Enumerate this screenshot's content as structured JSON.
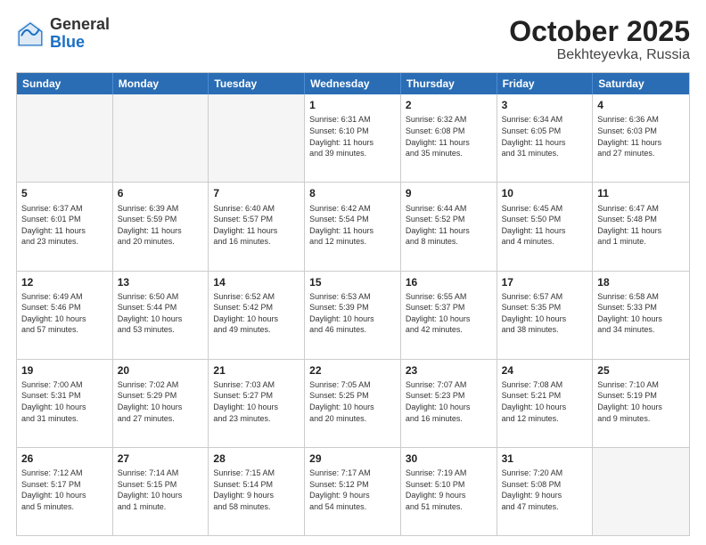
{
  "header": {
    "logo": {
      "general": "General",
      "blue": "Blue"
    },
    "month": "October 2025",
    "location": "Bekhteyevka, Russia"
  },
  "weekdays": [
    "Sunday",
    "Monday",
    "Tuesday",
    "Wednesday",
    "Thursday",
    "Friday",
    "Saturday"
  ],
  "rows": [
    [
      {
        "day": "",
        "info": ""
      },
      {
        "day": "",
        "info": ""
      },
      {
        "day": "",
        "info": ""
      },
      {
        "day": "1",
        "info": "Sunrise: 6:31 AM\nSunset: 6:10 PM\nDaylight: 11 hours\nand 39 minutes."
      },
      {
        "day": "2",
        "info": "Sunrise: 6:32 AM\nSunset: 6:08 PM\nDaylight: 11 hours\nand 35 minutes."
      },
      {
        "day": "3",
        "info": "Sunrise: 6:34 AM\nSunset: 6:05 PM\nDaylight: 11 hours\nand 31 minutes."
      },
      {
        "day": "4",
        "info": "Sunrise: 6:36 AM\nSunset: 6:03 PM\nDaylight: 11 hours\nand 27 minutes."
      }
    ],
    [
      {
        "day": "5",
        "info": "Sunrise: 6:37 AM\nSunset: 6:01 PM\nDaylight: 11 hours\nand 23 minutes."
      },
      {
        "day": "6",
        "info": "Sunrise: 6:39 AM\nSunset: 5:59 PM\nDaylight: 11 hours\nand 20 minutes."
      },
      {
        "day": "7",
        "info": "Sunrise: 6:40 AM\nSunset: 5:57 PM\nDaylight: 11 hours\nand 16 minutes."
      },
      {
        "day": "8",
        "info": "Sunrise: 6:42 AM\nSunset: 5:54 PM\nDaylight: 11 hours\nand 12 minutes."
      },
      {
        "day": "9",
        "info": "Sunrise: 6:44 AM\nSunset: 5:52 PM\nDaylight: 11 hours\nand 8 minutes."
      },
      {
        "day": "10",
        "info": "Sunrise: 6:45 AM\nSunset: 5:50 PM\nDaylight: 11 hours\nand 4 minutes."
      },
      {
        "day": "11",
        "info": "Sunrise: 6:47 AM\nSunset: 5:48 PM\nDaylight: 11 hours\nand 1 minute."
      }
    ],
    [
      {
        "day": "12",
        "info": "Sunrise: 6:49 AM\nSunset: 5:46 PM\nDaylight: 10 hours\nand 57 minutes."
      },
      {
        "day": "13",
        "info": "Sunrise: 6:50 AM\nSunset: 5:44 PM\nDaylight: 10 hours\nand 53 minutes."
      },
      {
        "day": "14",
        "info": "Sunrise: 6:52 AM\nSunset: 5:42 PM\nDaylight: 10 hours\nand 49 minutes."
      },
      {
        "day": "15",
        "info": "Sunrise: 6:53 AM\nSunset: 5:39 PM\nDaylight: 10 hours\nand 46 minutes."
      },
      {
        "day": "16",
        "info": "Sunrise: 6:55 AM\nSunset: 5:37 PM\nDaylight: 10 hours\nand 42 minutes."
      },
      {
        "day": "17",
        "info": "Sunrise: 6:57 AM\nSunset: 5:35 PM\nDaylight: 10 hours\nand 38 minutes."
      },
      {
        "day": "18",
        "info": "Sunrise: 6:58 AM\nSunset: 5:33 PM\nDaylight: 10 hours\nand 34 minutes."
      }
    ],
    [
      {
        "day": "19",
        "info": "Sunrise: 7:00 AM\nSunset: 5:31 PM\nDaylight: 10 hours\nand 31 minutes."
      },
      {
        "day": "20",
        "info": "Sunrise: 7:02 AM\nSunset: 5:29 PM\nDaylight: 10 hours\nand 27 minutes."
      },
      {
        "day": "21",
        "info": "Sunrise: 7:03 AM\nSunset: 5:27 PM\nDaylight: 10 hours\nand 23 minutes."
      },
      {
        "day": "22",
        "info": "Sunrise: 7:05 AM\nSunset: 5:25 PM\nDaylight: 10 hours\nand 20 minutes."
      },
      {
        "day": "23",
        "info": "Sunrise: 7:07 AM\nSunset: 5:23 PM\nDaylight: 10 hours\nand 16 minutes."
      },
      {
        "day": "24",
        "info": "Sunrise: 7:08 AM\nSunset: 5:21 PM\nDaylight: 10 hours\nand 12 minutes."
      },
      {
        "day": "25",
        "info": "Sunrise: 7:10 AM\nSunset: 5:19 PM\nDaylight: 10 hours\nand 9 minutes."
      }
    ],
    [
      {
        "day": "26",
        "info": "Sunrise: 7:12 AM\nSunset: 5:17 PM\nDaylight: 10 hours\nand 5 minutes."
      },
      {
        "day": "27",
        "info": "Sunrise: 7:14 AM\nSunset: 5:15 PM\nDaylight: 10 hours\nand 1 minute."
      },
      {
        "day": "28",
        "info": "Sunrise: 7:15 AM\nSunset: 5:14 PM\nDaylight: 9 hours\nand 58 minutes."
      },
      {
        "day": "29",
        "info": "Sunrise: 7:17 AM\nSunset: 5:12 PM\nDaylight: 9 hours\nand 54 minutes."
      },
      {
        "day": "30",
        "info": "Sunrise: 7:19 AM\nSunset: 5:10 PM\nDaylight: 9 hours\nand 51 minutes."
      },
      {
        "day": "31",
        "info": "Sunrise: 7:20 AM\nSunset: 5:08 PM\nDaylight: 9 hours\nand 47 minutes."
      },
      {
        "day": "",
        "info": ""
      }
    ]
  ]
}
